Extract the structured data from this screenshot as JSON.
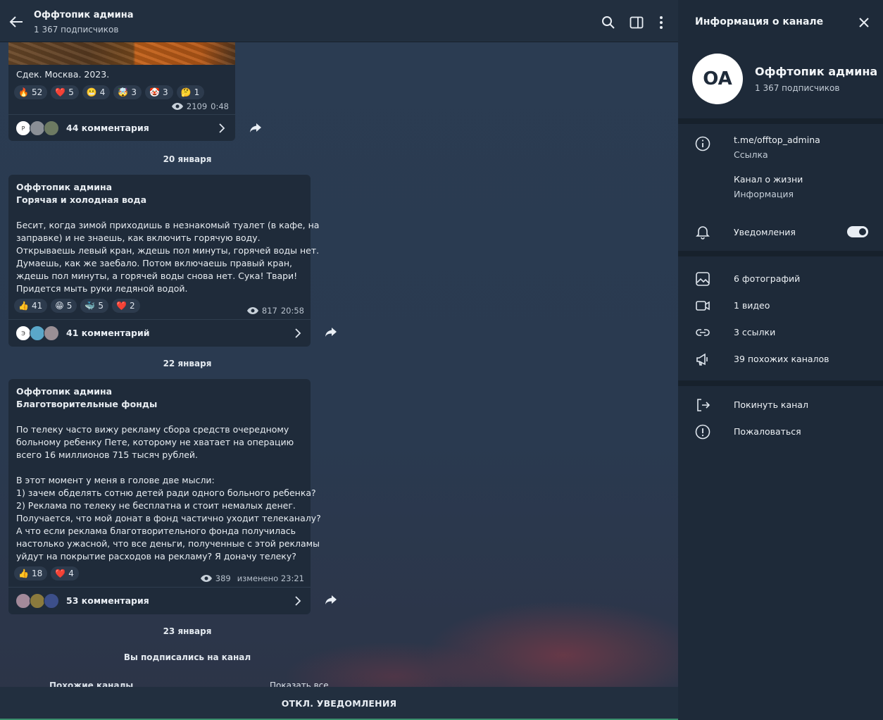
{
  "header": {
    "title": "Оффтопик админа",
    "subtitle": "1 367 подписчиков"
  },
  "post1": {
    "caption": "Сдек. Москва. 2023.",
    "reactions": [
      {
        "emoji": "🔥",
        "count": "52"
      },
      {
        "emoji": "❤️",
        "count": "5"
      },
      {
        "emoji": "😬",
        "count": "4"
      },
      {
        "emoji": "🤯",
        "count": "3"
      },
      {
        "emoji": "🤡",
        "count": "3"
      },
      {
        "emoji": "🤔",
        "count": "1"
      }
    ],
    "views": "2109",
    "time": "0:48",
    "comments": "44 комментария",
    "avatar_letter": "Р"
  },
  "date1": "20 января",
  "post2": {
    "author": "Оффтопик админа",
    "heading": "Горячая и холодная вода",
    "lines": [
      "Бесит, когда зимой приходишь в незнакомый туалет (в кафе, на",
      "заправке) и не знаешь, как включить горячую воду.",
      "Открываешь левый кран, ждешь пол минуты, горячей воды нет.",
      "Думаешь, как же заебало. Потом включаешь правый кран,",
      "ждешь пол минуты, а горячей воды снова нет. Сука! Твари!",
      "Придется мыть руки ледяной водой."
    ],
    "reactions": [
      {
        "emoji": "👍",
        "count": "41"
      },
      {
        "emoji": "😁",
        "count": "5"
      },
      {
        "emoji": "🐳",
        "count": "5"
      },
      {
        "emoji": "❤️",
        "count": "2"
      }
    ],
    "views": "817",
    "time": "20:58",
    "comments": "41 комментарий",
    "avatar_letter": "Э"
  },
  "date2": "22 января",
  "post3": {
    "author": "Оффтопик админа",
    "heading": "Благотворительные фонды",
    "lines": [
      "По телеку часто вижу рекламу сбора средств очередному",
      "больному ребенку Пете, которому не хватает на операцию",
      "всего 16 миллионов 715 тысяч рублей.",
      "",
      "В этот момент у меня в голове две мысли:",
      "1) зачем обделять сотню детей ради одного больного ребенка?",
      "2) Реклама по телеку не бесплатна и стоит немалых денег.",
      "Получается, что мой донат в фонд частично уходит телеканалу?",
      "А что если реклама благотворительного фонда получилась",
      "настолько ужасной, что все деньги, полученные с этой рекламы",
      "уйдут на покрытие расходов на рекламу? Я доначу телеку?"
    ],
    "reactions": [
      {
        "emoji": "👍",
        "count": "18"
      },
      {
        "emoji": "❤️",
        "count": "4"
      }
    ],
    "views": "389",
    "time": "изменено 23:21",
    "comments": "53 комментария"
  },
  "date3": "23 января",
  "service_msg": "Вы подписались на канал",
  "similar": {
    "left": "Похожие каналы",
    "right": "Показать все"
  },
  "bottom_button": "ОТКЛ. УВЕДОМЛЕНИЯ",
  "side": {
    "title": "Информация о канале",
    "avatar_initials": "OA",
    "name": "Оффтопик админа",
    "subscribers": "1 367 подписчиков",
    "link": "t.me/offtop_admina",
    "link_label": "Ссылка",
    "description": "Канал о жизни",
    "description_label": "Информация",
    "notifications": "Уведомления",
    "notifications_on": true,
    "media": [
      {
        "icon": "image-icon",
        "label": "6 фотографий"
      },
      {
        "icon": "video-icon",
        "label": "1 видео"
      },
      {
        "icon": "link-icon",
        "label": "3 ссылки"
      },
      {
        "icon": "megaphone-icon",
        "label": "39 похожих каналов"
      }
    ],
    "leave": "Покинуть канал",
    "report": "Пожаловаться"
  }
}
